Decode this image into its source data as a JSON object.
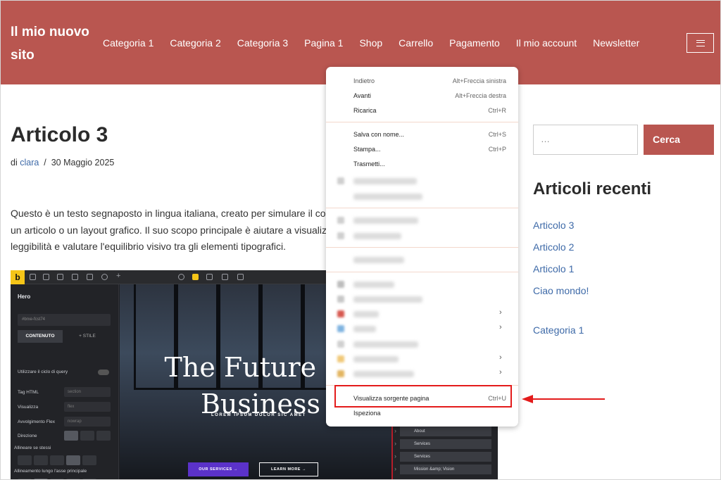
{
  "site": {
    "title": "Il mio nuovo sito",
    "nav": [
      "Categoria 1",
      "Categoria 2",
      "Categoria 3",
      "Pagina 1",
      "Shop",
      "Carrello",
      "Pagamento",
      "Il mio account",
      "Newsletter"
    ],
    "header_color": "#b95650"
  },
  "post": {
    "title": "Articolo 3",
    "meta_prefix": "di",
    "author": "clara",
    "sep": "/",
    "date": "30 Maggio 2025",
    "body_lines": [
      "Questo è un testo segnaposto in lingua italiana, creato per simulare il conten",
      "un articolo o un layout grafico. Il suo scopo principale è aiutare a visualizzare",
      "leggibilità e valutare l'equilibrio visivo tra gli elementi tipografici."
    ]
  },
  "builder": {
    "logo": "b",
    "panel_title": "Hero",
    "id_field": "#brxe-fcst74",
    "tab_content": "CONTENUTO",
    "tab_style": "+ STILE",
    "query_loop": "Utilizzare il ciclo di query",
    "rows": [
      {
        "label": "Tag HTML",
        "value": "section"
      },
      {
        "label": "Visualizza",
        "value": "flex"
      },
      {
        "label": "Avvolgimento Flex",
        "value": "nowrap"
      },
      {
        "label": "Direzione",
        "value": ""
      }
    ],
    "align_self": "Allineare se stessi",
    "align_main": "Allineamento lungo l'asse principale",
    "hero_heading": "The Future Of Business",
    "hero_sub": "LOREM IPSUM DOLOR SIC AMET",
    "btn_primary": "OUR SERVICES  →",
    "btn_secondary": "LEARN MORE  →",
    "structure": [
      "About",
      "Services",
      "Services",
      "Mission &amp; Vision"
    ]
  },
  "sidebar": {
    "search_placeholder": "…",
    "search_button": "Cerca",
    "recent_title": "Articoli recenti",
    "recent_links": [
      "Articolo 3",
      "Articolo 2",
      "Articolo 1",
      "Ciao mondo!"
    ],
    "category_link": "Categoria 1"
  },
  "context_menu": {
    "back": {
      "label": "Indietro",
      "shortcut": "Alt+Freccia sinistra"
    },
    "forward": {
      "label": "Avanti",
      "shortcut": "Alt+Freccia destra"
    },
    "reload": {
      "label": "Ricarica",
      "shortcut": "Ctrl+R"
    },
    "save_as": {
      "label": "Salva con nome...",
      "shortcut": "Ctrl+S"
    },
    "print": {
      "label": "Stampa...",
      "shortcut": "Ctrl+P"
    },
    "cast": {
      "label": "Trasmetti..."
    },
    "view_source": {
      "label": "Visualizza sorgente pagina",
      "shortcut": "Ctrl+U"
    },
    "inspect": {
      "label": "Ispeziona"
    },
    "highlight_color": "#e31b1b"
  }
}
